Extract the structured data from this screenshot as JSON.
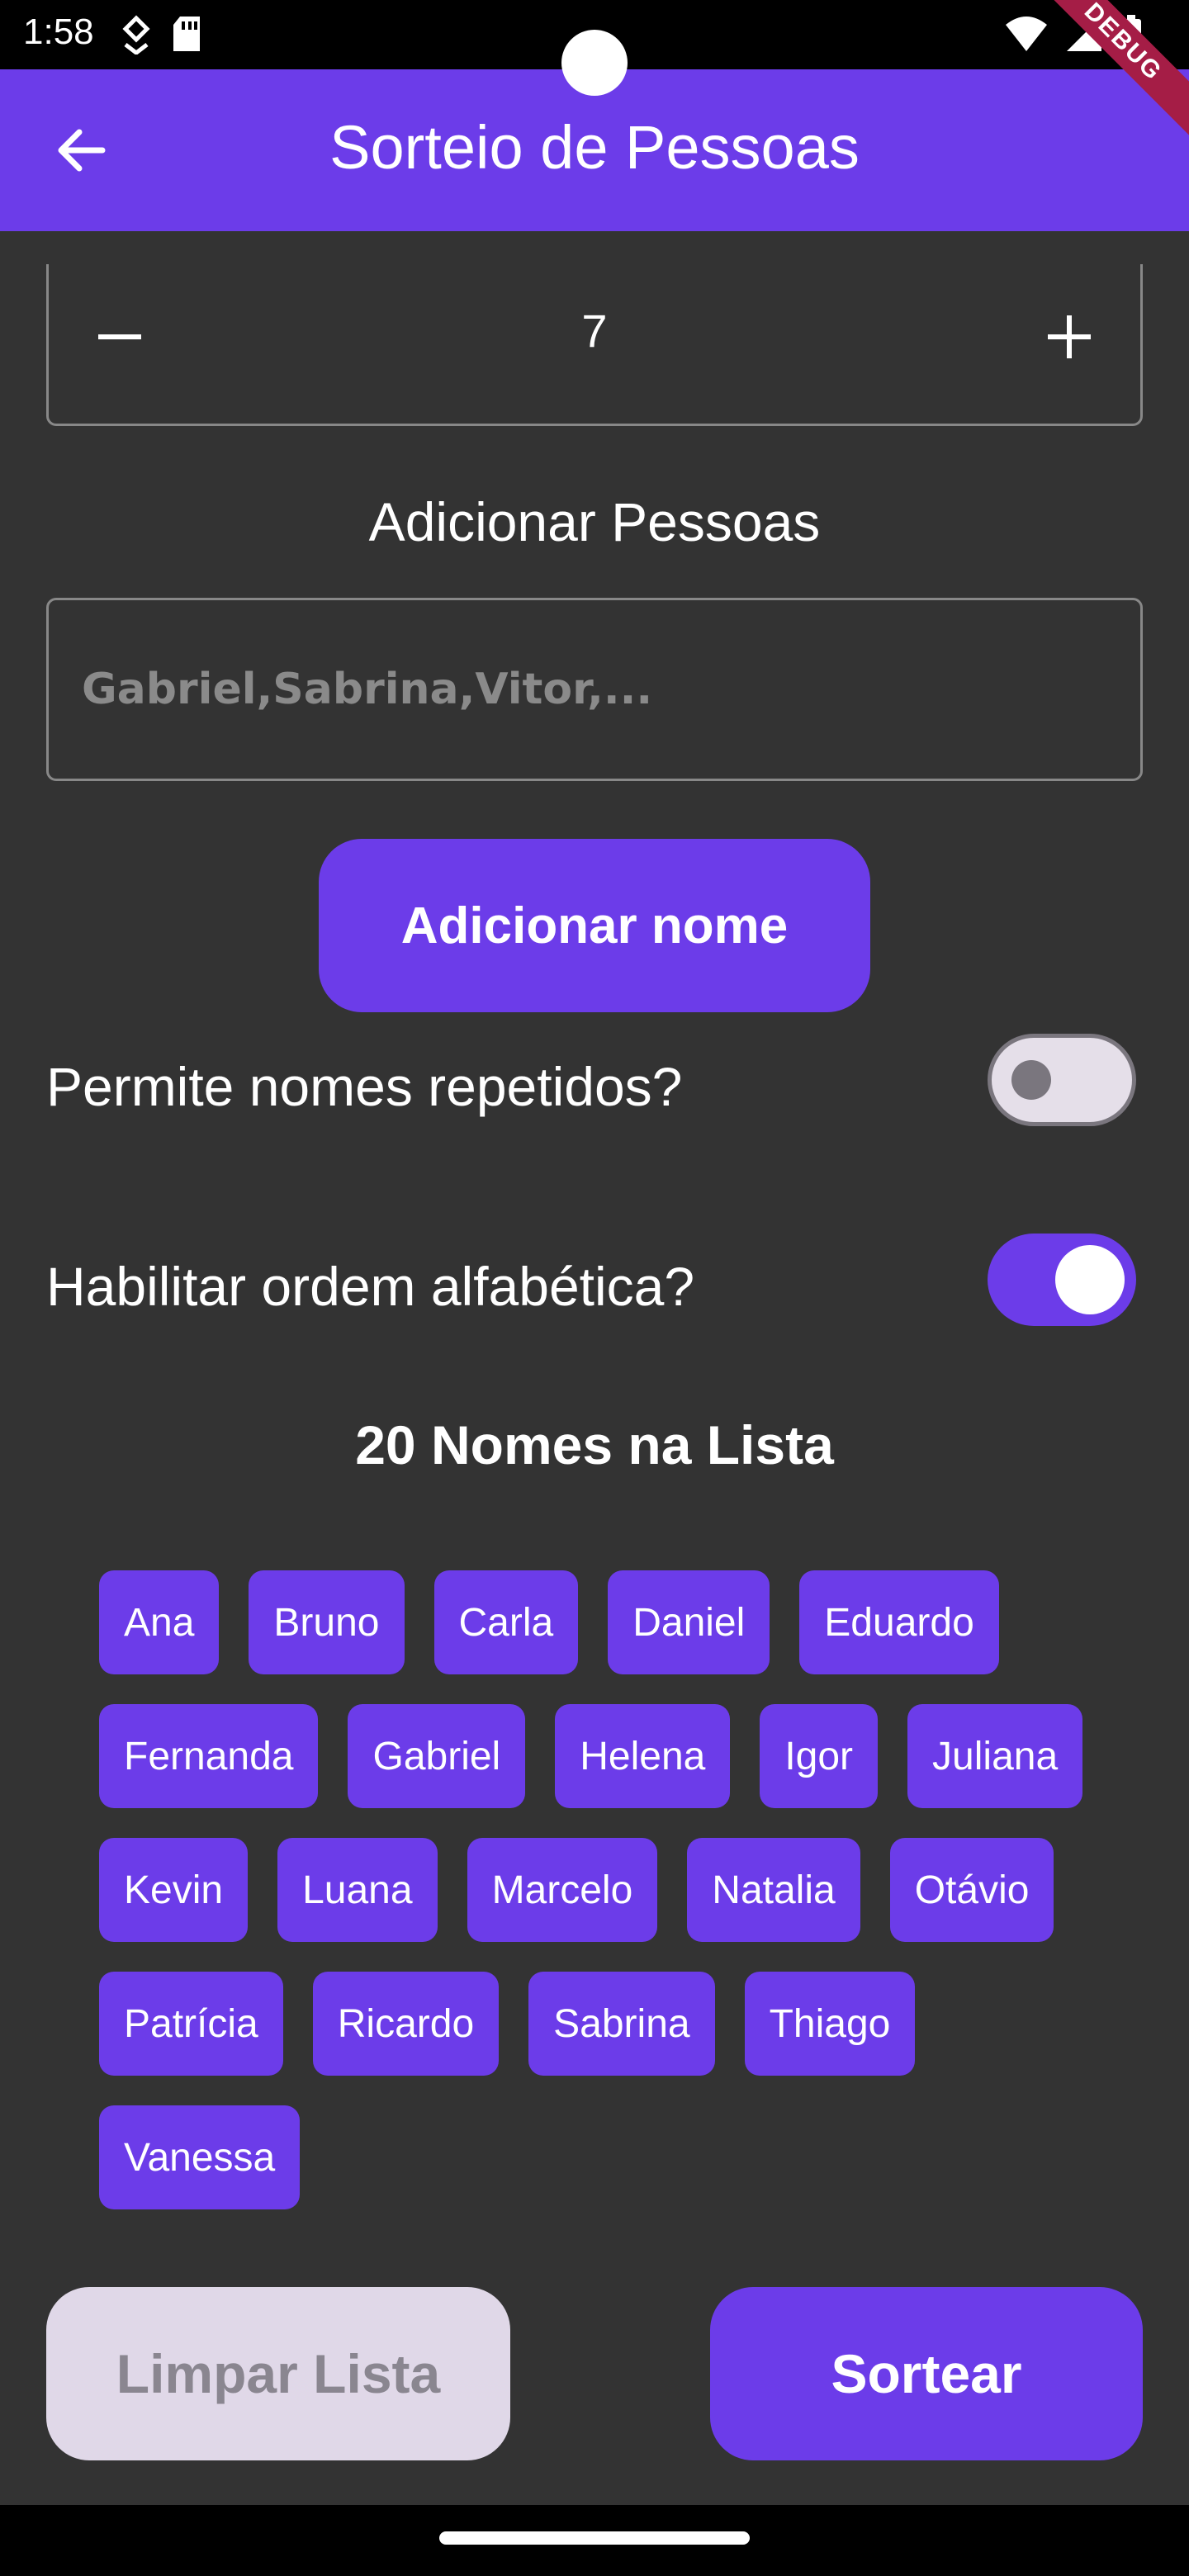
{
  "status_bar": {
    "time": "1:58",
    "icons_left": [
      "download-icon",
      "sd-card-icon"
    ],
    "icons_right": [
      "wifi-icon",
      "signal-icon",
      "battery-icon"
    ]
  },
  "app_bar": {
    "title": "Sorteio de Pessoas",
    "back_icon": "arrow-left-icon",
    "debug_label": "DEBUG",
    "color": "#6c3ce9"
  },
  "stepper": {
    "value": "7",
    "minus_icon": "minus-icon",
    "plus_icon": "plus-icon"
  },
  "add_section": {
    "title": "Adicionar Pessoas",
    "input_placeholder": "Gabriel,Sabrina,Vitor,...",
    "input_value": "",
    "add_button_label": "Adicionar nome"
  },
  "toggles": {
    "repeated_label": "Permite nomes repetidos?",
    "repeated_on": false,
    "alphabetical_label": "Habilitar ordem alfabética?",
    "alphabetical_on": true
  },
  "list": {
    "count_label": "20 Nomes na Lista",
    "rows": [
      [
        "Ana",
        "Bruno",
        "Carla",
        "Daniel",
        "Eduardo"
      ],
      [
        "Fernanda",
        "Gabriel",
        "Helena",
        "Igor",
        "Juliana"
      ],
      [
        "Kevin",
        "Luana",
        "Marcelo",
        "Natalia",
        "Otávio"
      ],
      [
        "Patrícia",
        "Ricardo",
        "Sabrina",
        "Thiago"
      ],
      [
        "Vanessa"
      ]
    ]
  },
  "actions": {
    "clear_label": "Limpar Lista",
    "draw_label": "Sortear"
  },
  "colors": {
    "accent": "#6c3ce9",
    "background": "#333333",
    "clear_button_bg": "#e0d8e8"
  }
}
